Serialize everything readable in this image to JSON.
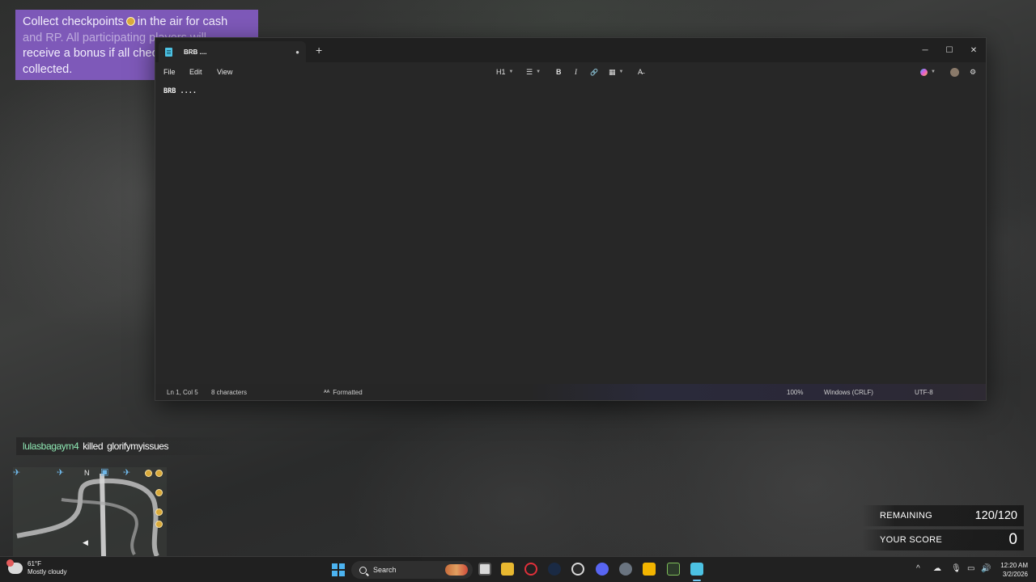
{
  "objective": {
    "line1a": "Collect checkpoints",
    "line1b": "in the air for cash",
    "line2": "and RP. All participating players will",
    "line3": "receive a bonus if all checkpoints are",
    "line4": "collected."
  },
  "notepad": {
    "tab_title": "BRB ....",
    "new_tab": "+",
    "controls": {
      "minimize": "─",
      "maximize": "☐",
      "close": "✕"
    },
    "menu": {
      "file": "File",
      "edit": "Edit",
      "view": "View"
    },
    "toolbar": {
      "heading": "H1",
      "list": "☰",
      "bold": "B",
      "italic": "I",
      "link": "🔗",
      "table": "▦",
      "clear": "A̶"
    },
    "content": "BRB ....",
    "status": {
      "position": "Ln 1, Col 5",
      "characters": "8 characters",
      "format": "Formatted",
      "zoom": "100%",
      "line_ending": "Windows (CRLF)",
      "encoding": "UTF-8"
    }
  },
  "killfeed": {
    "killer": "lulasbagaym4",
    "verb": "killed",
    "victim": "glorifymyissues"
  },
  "minimap": {
    "north": "N"
  },
  "hud": {
    "remaining_label": "REMAINING",
    "remaining_value": "120/120",
    "score_label": "YOUR SCORE",
    "score_value": "0"
  },
  "taskbar": {
    "weather_temp": "61°F",
    "weather_desc": "Mostly cloudy",
    "search": "Search",
    "time": "12:20 AM",
    "date": "3/2/2026"
  },
  "colors": {
    "objective_bg": "#845cc4",
    "killer_name": "#8fe9b4",
    "coin": "#d9a93a",
    "notepad_bg": "#272727"
  }
}
